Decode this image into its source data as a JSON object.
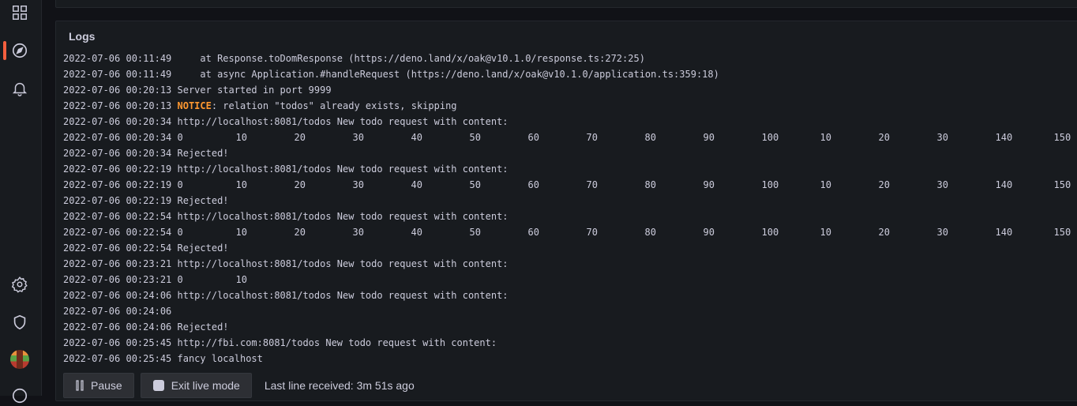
{
  "nav": {
    "icons": [
      "apps-icon",
      "explore-icon",
      "alerting-bell-icon",
      "settings-gear-icon",
      "shield-icon",
      "user-avatar",
      "help-icon"
    ]
  },
  "panel": {
    "title": "Logs"
  },
  "logs": [
    {
      "ts": "2022-07-06 00:11:49",
      "msg": "    at Response.toDomResponse (https://deno.land/x/oak@v10.1.0/response.ts:272:25)"
    },
    {
      "ts": "2022-07-06 00:11:49",
      "msg": "    at async Application.#handleRequest (https://deno.land/x/oak@v10.1.0/application.ts:359:18)"
    },
    {
      "ts": "2022-07-06 00:20:13",
      "msg": "Server started in port 9999"
    },
    {
      "ts": "2022-07-06 00:20:13",
      "notice": "NOTICE",
      "msg": ": relation \"todos\" already exists, skipping"
    },
    {
      "ts": "2022-07-06 00:20:34",
      "msg": "http://localhost:8081/todos New todo request with content:"
    },
    {
      "ts": "2022-07-06 00:20:34",
      "cells": [
        "0",
        "10",
        "20",
        "30",
        "40",
        "50",
        "60",
        "70",
        "80",
        "90",
        "100",
        "10",
        "20",
        "30",
        "140",
        "150"
      ]
    },
    {
      "ts": "2022-07-06 00:20:34",
      "msg": "Rejected!"
    },
    {
      "ts": "2022-07-06 00:22:19",
      "msg": "http://localhost:8081/todos New todo request with content:"
    },
    {
      "ts": "2022-07-06 00:22:19",
      "cells": [
        "0",
        "10",
        "20",
        "30",
        "40",
        "50",
        "60",
        "70",
        "80",
        "90",
        "100",
        "10",
        "20",
        "30",
        "140",
        "150"
      ]
    },
    {
      "ts": "2022-07-06 00:22:19",
      "msg": "Rejected!"
    },
    {
      "ts": "2022-07-06 00:22:54",
      "msg": "http://localhost:8081/todos New todo request with content:"
    },
    {
      "ts": "2022-07-06 00:22:54",
      "cells": [
        "0",
        "10",
        "20",
        "30",
        "40",
        "50",
        "60",
        "70",
        "80",
        "90",
        "100",
        "10",
        "20",
        "30",
        "140",
        "150"
      ]
    },
    {
      "ts": "2022-07-06 00:22:54",
      "msg": "Rejected!"
    },
    {
      "ts": "2022-07-06 00:23:21",
      "msg": "http://localhost:8081/todos New todo request with content:"
    },
    {
      "ts": "2022-07-06 00:23:21",
      "cells": [
        "0",
        "10"
      ]
    },
    {
      "ts": "2022-07-06 00:24:06",
      "msg": "http://localhost:8081/todos New todo request with content:"
    },
    {
      "ts": "2022-07-06 00:24:06",
      "msg": ""
    },
    {
      "ts": "2022-07-06 00:24:06",
      "msg": "Rejected!"
    },
    {
      "ts": "2022-07-06 00:25:45",
      "msg": "http://fbi.com:8081/todos New todo request with content:"
    },
    {
      "ts": "2022-07-06 00:25:45",
      "msg": "fancy localhost"
    }
  ],
  "footer": {
    "pause_label": "Pause",
    "exit_live_label": "Exit live mode",
    "status": "Last line received: 3m 51s ago"
  },
  "colors": {
    "accent": "#f55f3e",
    "notice": "#ff9830",
    "background": "#111217",
    "panel": "#181b1f"
  }
}
